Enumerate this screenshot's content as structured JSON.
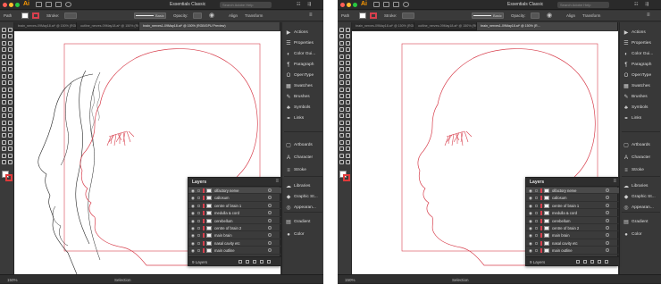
{
  "screenshots": [
    {
      "id": "left",
      "app": {
        "title": "Essentials Classic",
        "search_placeholder": "Search Adobe Help",
        "logo": "Ai"
      },
      "control_bar": {
        "mode": "Path",
        "stroke_label": "Stroke:",
        "basic_label": "Basic",
        "opacity_label": "Opacity:",
        "style_label": "Style:",
        "align_label": "Align",
        "transform_label": "Transform"
      },
      "tabs": [
        {
          "label": "brain_nerves-09May18.ai* @ 150% (RGB...",
          "active": false
        },
        {
          "label": "outline_nerves-09May18.ai* @ 150% (RGB...",
          "active": false
        },
        {
          "label": "brain_nerves1-09May18.ai* @ 150% (RGB/GPU Preview)",
          "active": true
        }
      ],
      "right_panel": [
        "Actions",
        "Properties",
        "Color Gui...",
        "Paragraph",
        "OpenType",
        "Swatches",
        "Brushes",
        "Symbols",
        "Links",
        "Artboards",
        "Character",
        "Stroke",
        "Libraries",
        "Graphic St...",
        "Appearan...",
        "Gradient",
        "Color"
      ],
      "layers_panel": {
        "title": "Layers",
        "rows": [
          {
            "name": "olfactory nerve",
            "selected": true
          },
          {
            "name": "callosum",
            "selected": false
          },
          {
            "name": "centre of brain 1",
            "selected": false
          },
          {
            "name": "medulla & cord",
            "selected": false
          },
          {
            "name": "cerebellum",
            "selected": false
          },
          {
            "name": "centre of brain 2",
            "selected": false
          },
          {
            "name": "main brain",
            "selected": false
          },
          {
            "name": "nasal cavity etc",
            "selected": false
          },
          {
            "name": "main outline",
            "selected": false
          }
        ],
        "footer_count": "9 Layers"
      },
      "status": {
        "zoom": "150%",
        "tool": "Selection"
      },
      "show_skull_and_brain": true
    },
    {
      "id": "right",
      "app": {
        "title": "Essentials Classic",
        "search_placeholder": "Search Adobe Help",
        "logo": "Ai"
      },
      "control_bar": {
        "mode": "Path",
        "stroke_label": "Stroke:",
        "basic_label": "Basic",
        "opacity_label": "Opacity:",
        "style_label": "Style:",
        "align_label": "Align",
        "transform_label": "Transform"
      },
      "tabs": [
        {
          "label": "brain_nerves-09May18.ai* @ 150% (RGB...",
          "active": false
        },
        {
          "label": "outline_nerves-09May18.ai* @ 150% (RGB...",
          "active": false
        },
        {
          "label": "brain_nerves1-09May18.ai* @ 150% (R...",
          "active": true
        }
      ],
      "right_panel": [
        "Actions",
        "Properties",
        "Color Gui...",
        "Paragraph",
        "OpenType",
        "Swatches",
        "Brushes",
        "Symbols",
        "Links",
        "Artboards",
        "Character",
        "Stroke",
        "Libraries",
        "Graphic St...",
        "Appearan...",
        "Gradient",
        "Color"
      ],
      "layers_panel": {
        "title": "Layers",
        "rows": [
          {
            "name": "olfactory nerve",
            "selected": true
          },
          {
            "name": "callosum",
            "selected": false
          },
          {
            "name": "centre of brain 1",
            "selected": false
          },
          {
            "name": "medulla & cord",
            "selected": false
          },
          {
            "name": "cerebellum",
            "selected": false
          },
          {
            "name": "centre of brain 2",
            "selected": false
          },
          {
            "name": "main brain",
            "selected": false
          },
          {
            "name": "nasal cavity etc",
            "selected": false
          },
          {
            "name": "main outline",
            "selected": false
          }
        ],
        "footer_count": "9 Layers"
      },
      "status": {
        "zoom": "150%",
        "tool": "Selection"
      },
      "show_skull_and_brain": false
    }
  ],
  "colors": {
    "accent_red": "#d8404e",
    "ui_dark": "#323232",
    "canvas": "#ffffff"
  },
  "icons": [
    "search-icon",
    "eye-icon",
    "lock-icon",
    "menu-icon",
    "trash-icon",
    "new-layer-icon"
  ]
}
